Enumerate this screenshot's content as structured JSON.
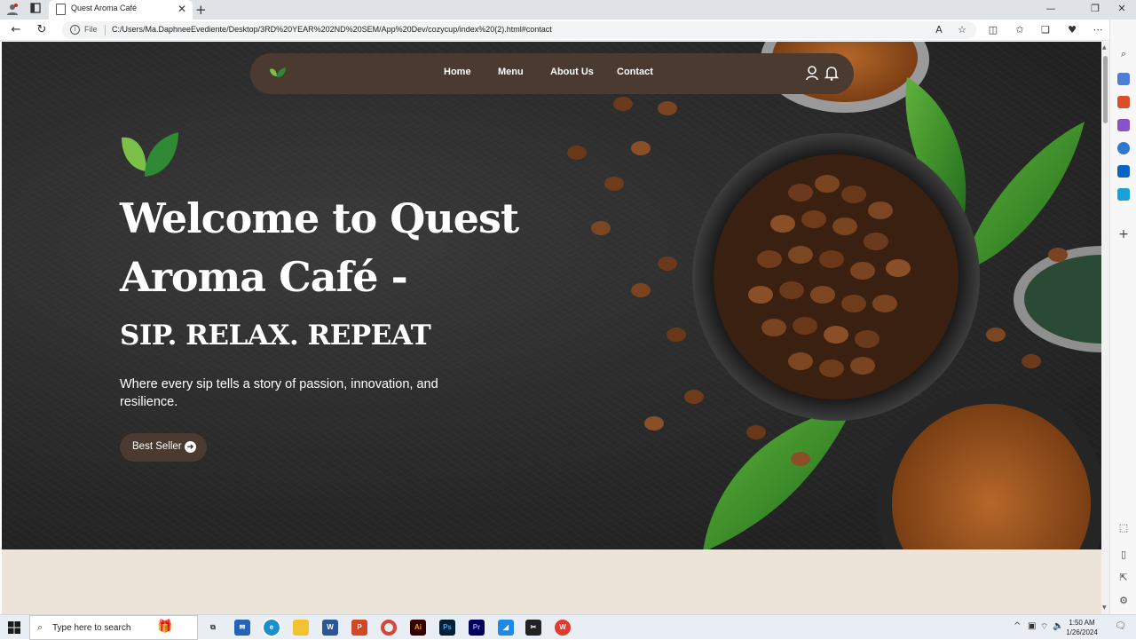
{
  "browser": {
    "tab_title": "Quest Aroma Café",
    "address_protocol": "File",
    "address_url": "C:/Users/Ma.DaphneeEvediente/Desktop/3RD%20YEAR%202ND%20SEM/App%20Dev/cozycup/index%20(2).html#contact"
  },
  "site": {
    "nav": {
      "links": [
        "Home",
        "Menu",
        "About Us",
        "Contact"
      ],
      "icons": [
        "user-icon",
        "bell-icon"
      ]
    },
    "hero": {
      "title": "Welcome to Quest Aroma Café -",
      "subtitle": "SIP. RELAX. REPEAT",
      "description": "Where every sip tells a story of passion, innovation, and resilience.",
      "cta_label": "Best Seller"
    },
    "colors": {
      "nav_bg": "#4a3a2f",
      "leaf_green": "#5aa83a",
      "section_bg": "#ede4d8"
    }
  },
  "taskbar": {
    "search_placeholder": "Type here to search",
    "time": "1:50 AM",
    "date": "1/26/2024"
  }
}
